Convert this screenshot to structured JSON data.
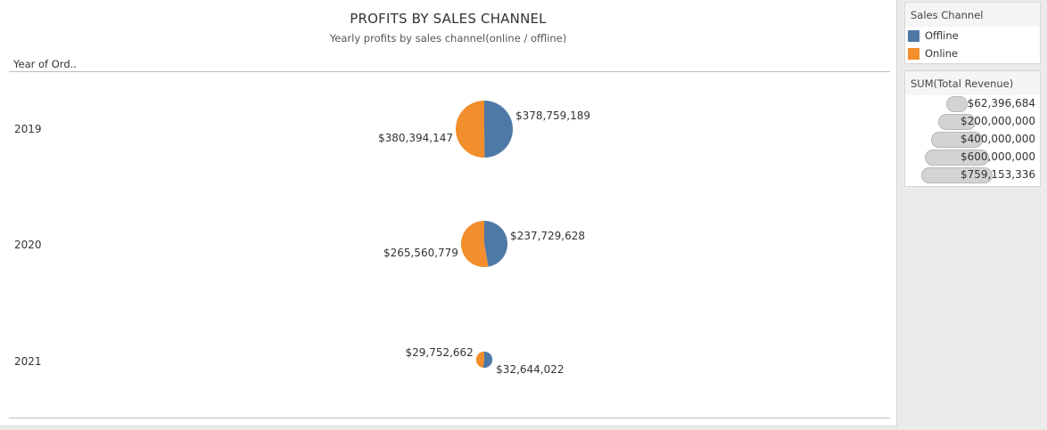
{
  "chart_data": {
    "type": "pie",
    "title": "PROFITS BY SALES CHANNEL",
    "subtitle": "Yearly profits by sales channel(online / offline)",
    "row_header": "Year of Ord..",
    "categories": [
      "2019",
      "2020",
      "2021"
    ],
    "series": [
      {
        "name": "Offline",
        "color": "#4e79a7",
        "values": [
          378759189,
          237729628,
          32644022
        ],
        "labels": [
          "$378,759,189",
          "$237,729,628",
          "$32,644,022"
        ]
      },
      {
        "name": "Online",
        "color": "#f28e2b",
        "values": [
          380394147,
          265560779,
          29752662
        ],
        "labels": [
          "$380,394,147",
          "$265,560,779",
          "$29,752,662"
        ]
      }
    ],
    "size_measure": "SUM(Total Revenue)"
  },
  "legend": {
    "color_title": "Sales Channel",
    "items": [
      {
        "label": "Offline",
        "color": "#4e79a7"
      },
      {
        "label": "Online",
        "color": "#f28e2b"
      }
    ],
    "size_title": "SUM(Total Revenue)",
    "size_items": [
      "$62,396,684",
      "$200,000,000",
      "$400,000,000",
      "$600,000,000",
      "$759,153,336"
    ],
    "size_values": [
      62396684,
      200000000,
      400000000,
      600000000,
      759153336
    ]
  }
}
